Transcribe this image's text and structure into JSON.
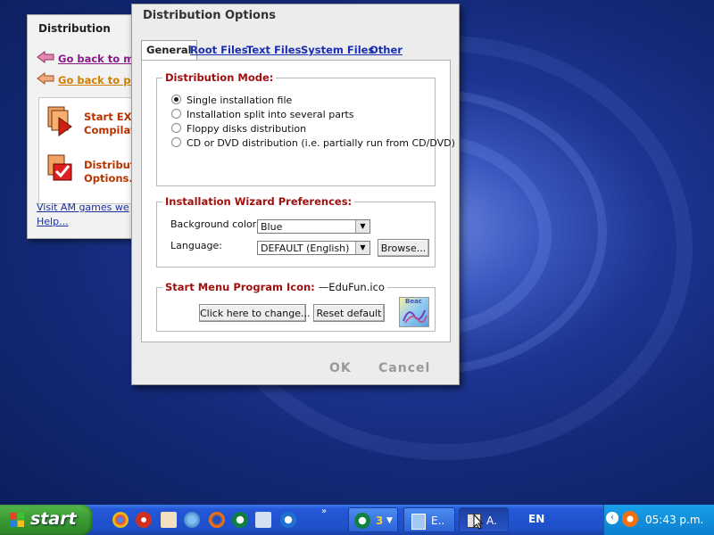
{
  "back_panel": {
    "title": "Distribution",
    "link_main": "Go back to mai",
    "link_pro": "Go back to pro",
    "action1_line1": "Start EXE",
    "action1_line2": "Compilati",
    "action2_line1": "Distributi",
    "action2_line2": "Options...",
    "visit_link": "Visit AM games we",
    "help_link": "Help..."
  },
  "dialog": {
    "title": "Distribution Options",
    "tabs": [
      {
        "label": "General",
        "active": true
      },
      {
        "label": "Root Files",
        "active": false
      },
      {
        "label": "Text Files",
        "active": false
      },
      {
        "label": "System Files",
        "active": false
      },
      {
        "label": "Other",
        "active": false
      }
    ],
    "distribution_mode": {
      "title": "Distribution Mode:",
      "options": [
        {
          "label": "Single installation file",
          "selected": true
        },
        {
          "label": "Installation split into several parts",
          "selected": false
        },
        {
          "label": "Floppy disks distribution",
          "selected": false
        },
        {
          "label": "CD or DVD distribution (i.e. partially run from CD/DVD)",
          "selected": false
        }
      ]
    },
    "wizard_prefs": {
      "title": "Installation Wizard Preferences:",
      "bg_label": "Background color:",
      "bg_value": "Blue",
      "lang_label": "Language:",
      "lang_value": "DEFAULT (English)",
      "browse": "Browse..."
    },
    "start_menu": {
      "title": "Start Menu Program Icon:",
      "icon_file": "EduFun.ico",
      "change_btn": "Click here to change...",
      "reset_btn": "Reset default",
      "icon_caption": "Beac"
    },
    "ok": "OK",
    "cancel": "Cancel"
  },
  "taskbar": {
    "start": "start",
    "group_count": "3",
    "task1": "E..",
    "task2": "A.",
    "language": "EN",
    "clock": "05:43 p.m."
  },
  "colors": {
    "dialog_bg": "#ececec",
    "group_title": "#a01010",
    "link": "#1a2fb0",
    "taskbar": "#1f4fc8",
    "start": "#3a9a32",
    "tray": "#0c7fd0"
  }
}
